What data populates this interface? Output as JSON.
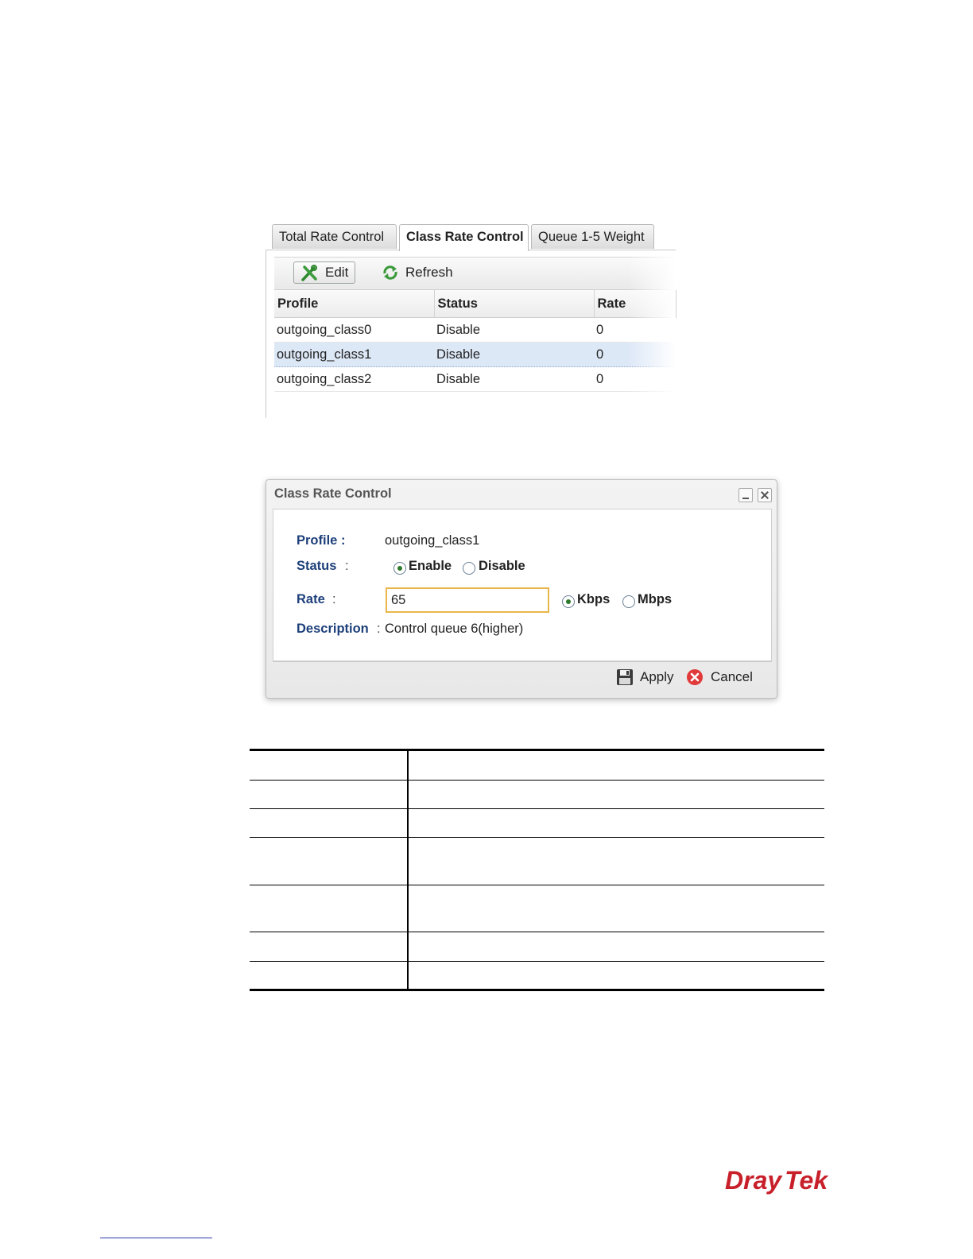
{
  "tabs": [
    {
      "label": "Total Rate Control",
      "active": false
    },
    {
      "label": "Class Rate Control",
      "active": true
    },
    {
      "label": "Queue 1-5 Weight",
      "active": false
    }
  ],
  "toolbar": {
    "edit_label": "Edit",
    "refresh_label": "Refresh",
    "edit_icon": "edit-tools-icon",
    "refresh_icon": "refresh-icon"
  },
  "grid": {
    "columns": [
      "Profile",
      "Status",
      "Rate"
    ],
    "rows": [
      {
        "profile": "outgoing_class0",
        "status": "Disable",
        "rate": "0",
        "selected": false
      },
      {
        "profile": "outgoing_class1",
        "status": "Disable",
        "rate": "0",
        "selected": true
      },
      {
        "profile": "outgoing_class2",
        "status": "Disable",
        "rate": "0",
        "selected": false
      }
    ]
  },
  "dialog": {
    "title": "Class Rate Control",
    "fields": {
      "profile_label": "Profile",
      "profile_value": "outgoing_class1",
      "status_label": "Status",
      "status_options": [
        "Enable",
        "Disable"
      ],
      "status_selected": "Enable",
      "rate_label": "Rate",
      "rate_value": "65",
      "rate_unit_options": [
        "Kbps",
        "Mbps"
      ],
      "rate_unit_selected": "Kbps",
      "description_label": "Description",
      "description_value": "Control queue 6(higher)"
    },
    "apply_label": "Apply",
    "cancel_label": "Cancel",
    "colon": ":"
  },
  "colors": {
    "label_blue": "#1d3f7a",
    "selected_row": "#dde8f7",
    "input_border": "#e8b64a",
    "logo_red": "#c8202a"
  },
  "logo": {
    "text_dray": "Dray",
    "text_tek": "Tek"
  }
}
